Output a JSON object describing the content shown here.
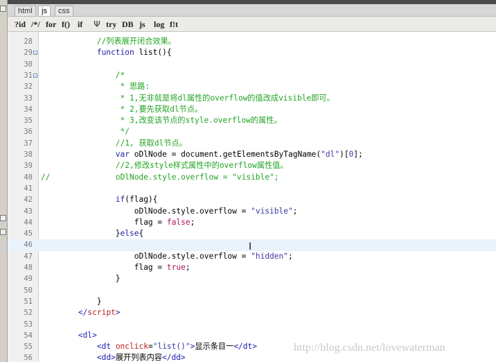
{
  "tabs": [
    {
      "label": "html",
      "active": false
    },
    {
      "label": "js",
      "active": true
    },
    {
      "label": "css",
      "active": false
    }
  ],
  "toolbar": [
    {
      "label": "?id",
      "name": "id-button"
    },
    {
      "label": "/*/",
      "name": "comment-button"
    },
    {
      "label": "for",
      "name": "for-button"
    },
    {
      "label": "f()",
      "name": "function-button"
    },
    {
      "label": "if",
      "name": "if-button"
    },
    {
      "label": "Ψ",
      "name": "regex-icon",
      "icon": true
    },
    {
      "label": "try",
      "name": "try-button"
    },
    {
      "label": "DB",
      "name": "db-button"
    },
    {
      "label": "js",
      "name": "js-button"
    },
    {
      "label": "log",
      "name": "log-button"
    },
    {
      "label": "f!t",
      "name": "fit-button"
    }
  ],
  "colors": {
    "comment": "#22a322",
    "keyword": "#2020a8",
    "string": "#3a3a9e",
    "bool": "#b0105a",
    "tag": "#1a1ab0",
    "attr": "#b52222",
    "line_highlight": "#eaf2fb"
  },
  "code": [
    {
      "n": "28",
      "tokens": [
        [
          "            ",
          "default"
        ],
        [
          "//列表展开闭合效果。",
          "comment"
        ]
      ]
    },
    {
      "n": "29",
      "fold": true,
      "tokens": [
        [
          "            ",
          "default"
        ],
        [
          "function",
          "keyword"
        ],
        [
          " list(){",
          "default"
        ]
      ]
    },
    {
      "n": "30",
      "tokens": []
    },
    {
      "n": "31",
      "fold": true,
      "tokens": [
        [
          "                ",
          "default"
        ],
        [
          "/*",
          "comment"
        ]
      ]
    },
    {
      "n": "32",
      "tokens": [
        [
          "                 ",
          "default"
        ],
        [
          "* 思路:",
          "comment"
        ]
      ]
    },
    {
      "n": "33",
      "tokens": [
        [
          "                 ",
          "default"
        ],
        [
          "* 1,无非就是将dl属性的overflow的值改成visible即可。",
          "comment"
        ]
      ]
    },
    {
      "n": "34",
      "tokens": [
        [
          "                 ",
          "default"
        ],
        [
          "* 2,要先获取dl节点。",
          "comment"
        ]
      ]
    },
    {
      "n": "35",
      "tokens": [
        [
          "                 ",
          "default"
        ],
        [
          "* 3,改变该节点的style.overflow的属性。",
          "comment"
        ]
      ]
    },
    {
      "n": "36",
      "tokens": [
        [
          "                 ",
          "default"
        ],
        [
          "*/",
          "comment"
        ]
      ]
    },
    {
      "n": "37",
      "tokens": [
        [
          "                ",
          "default"
        ],
        [
          "//1, 获取dl节点。",
          "comment"
        ]
      ]
    },
    {
      "n": "38",
      "tokens": [
        [
          "                ",
          "default"
        ],
        [
          "var",
          "keyword"
        ],
        [
          " oDlNode = document.getElementsByTagName(",
          "default"
        ],
        [
          "\"dl\"",
          "string"
        ],
        [
          ")[",
          "default"
        ],
        [
          "0",
          "num"
        ],
        [
          "];",
          "default"
        ]
      ]
    },
    {
      "n": "39",
      "tokens": [
        [
          "                ",
          "default"
        ],
        [
          "//2,修改style样式属性中的overflow属性值。",
          "comment"
        ]
      ]
    },
    {
      "n": "40",
      "tokens": [
        [
          "//              ",
          "comment"
        ],
        [
          "oDlNode.style.overflow = \"visible\";",
          "comment"
        ]
      ]
    },
    {
      "n": "41",
      "tokens": []
    },
    {
      "n": "42",
      "tokens": [
        [
          "                ",
          "default"
        ],
        [
          "if",
          "keyword"
        ],
        [
          "(flag){",
          "default"
        ]
      ]
    },
    {
      "n": "43",
      "tokens": [
        [
          "                    ",
          "default"
        ],
        [
          "oDlNode.style.overflow = ",
          "default"
        ],
        [
          "\"visible\"",
          "string"
        ],
        [
          ";",
          "default"
        ]
      ]
    },
    {
      "n": "44",
      "tokens": [
        [
          "                    ",
          "default"
        ],
        [
          "flag = ",
          "default"
        ],
        [
          "false",
          "bool"
        ],
        [
          ";",
          "default"
        ]
      ]
    },
    {
      "n": "45",
      "tokens": [
        [
          "                ",
          "default"
        ],
        [
          "}",
          "default"
        ],
        [
          "else",
          "keyword"
        ],
        [
          "{",
          "default"
        ]
      ]
    },
    {
      "n": "46",
      "highlight": true,
      "tokens": []
    },
    {
      "n": "47",
      "tokens": [
        [
          "                    ",
          "default"
        ],
        [
          "oDlNode.style.overflow = ",
          "default"
        ],
        [
          "\"hidden\"",
          "string"
        ],
        [
          ";",
          "default"
        ]
      ]
    },
    {
      "n": "48",
      "tokens": [
        [
          "                    ",
          "default"
        ],
        [
          "flag = ",
          "default"
        ],
        [
          "true",
          "bool"
        ],
        [
          ";",
          "default"
        ]
      ]
    },
    {
      "n": "49",
      "tokens": [
        [
          "                ",
          "default"
        ],
        [
          "}",
          "default"
        ]
      ]
    },
    {
      "n": "50",
      "tokens": []
    },
    {
      "n": "51",
      "tokens": [
        [
          "            ",
          "default"
        ],
        [
          "}",
          "default"
        ]
      ]
    },
    {
      "n": "52",
      "tokens": [
        [
          "        ",
          "default"
        ],
        [
          "</",
          "tag"
        ],
        [
          "script",
          "attr"
        ],
        [
          ">",
          "tag"
        ]
      ]
    },
    {
      "n": "53",
      "tokens": []
    },
    {
      "n": "54",
      "tokens": [
        [
          "        ",
          "default"
        ],
        [
          "<",
          "tag"
        ],
        [
          "dl",
          "tag"
        ],
        [
          ">",
          "tag"
        ]
      ]
    },
    {
      "n": "55",
      "tokens": [
        [
          "            ",
          "default"
        ],
        [
          "<",
          "tag"
        ],
        [
          "dt",
          "tag"
        ],
        [
          " ",
          "default"
        ],
        [
          "onclick",
          "attr"
        ],
        [
          "=",
          "default"
        ],
        [
          "\"list()\"",
          "string"
        ],
        [
          ">",
          "tag"
        ],
        [
          "显示条目一",
          "default"
        ],
        [
          "</",
          "tag"
        ],
        [
          "dt",
          "tag"
        ],
        [
          ">",
          "tag"
        ]
      ]
    },
    {
      "n": "56",
      "tokens": [
        [
          "            ",
          "default"
        ],
        [
          "<",
          "tag"
        ],
        [
          "dd",
          "tag"
        ],
        [
          ">",
          "tag"
        ],
        [
          "展开列表内容",
          "default"
        ],
        [
          "</",
          "tag"
        ],
        [
          "dd",
          "tag"
        ],
        [
          ">",
          "tag"
        ]
      ]
    }
  ],
  "watermark": "http://blog.csdn.net/lovewaterman",
  "cursor_icon": "ibeam-cursor-icon",
  "ibeam_glyph": "I"
}
